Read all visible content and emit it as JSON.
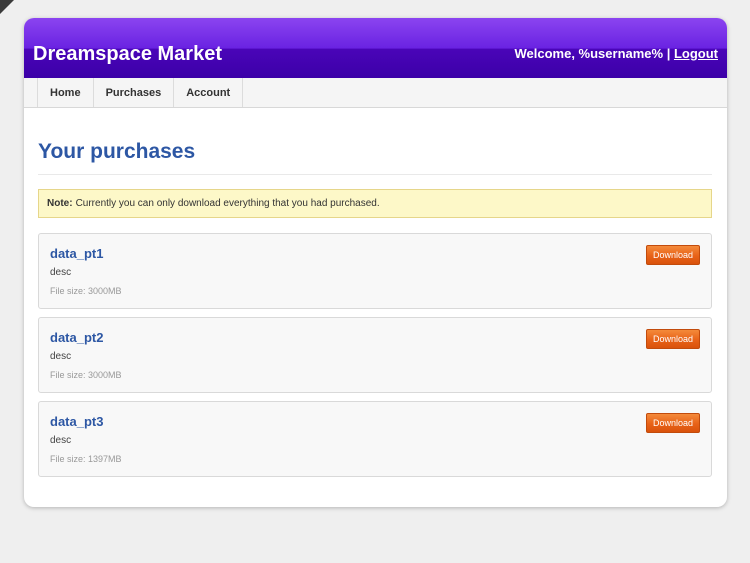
{
  "header": {
    "brand": "Dreamspace Market",
    "welcome_prefix": "Welcome, %username% | ",
    "logout_label": "Logout"
  },
  "nav": {
    "items": [
      {
        "label": "Home"
      },
      {
        "label": "Purchases"
      },
      {
        "label": "Account"
      }
    ]
  },
  "main": {
    "title": "Your purchases",
    "note": {
      "label": "Note:",
      "text": "Currently you can only download everything that you had purchased."
    },
    "purchases": [
      {
        "name": "data_pt1",
        "desc": "desc",
        "size": "File size: 3000MB",
        "button": "Download"
      },
      {
        "name": "data_pt2",
        "desc": "desc",
        "size": "File size: 3000MB",
        "button": "Download"
      },
      {
        "name": "data_pt3",
        "desc": "desc",
        "size": "File size: 1397MB",
        "button": "Download"
      }
    ]
  },
  "colors": {
    "header_gradient_top": "#8b44f0",
    "header_gradient_bottom": "#3c00a8",
    "title_blue": "#2d57a4",
    "download_orange": "#e86218",
    "note_background": "#fdf8c8"
  }
}
